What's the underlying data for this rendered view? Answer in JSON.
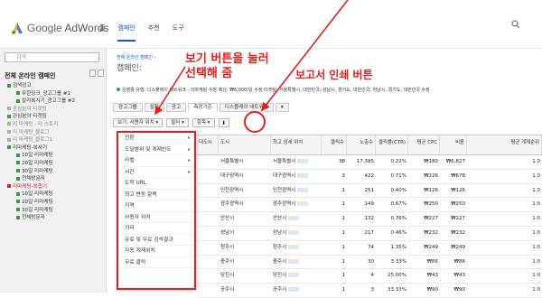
{
  "app": {
    "logo_google": "Google",
    "logo_product": "AdWords",
    "nav": [
      "홈",
      "캠페인",
      "추천",
      "도구"
    ]
  },
  "sidebar": {
    "search_placeholder": "검색",
    "title": "전체 온라인 캠페인",
    "items": [
      {
        "label": "검색광고",
        "level": 1,
        "state": "active"
      },
      {
        "label": "무한잉크_광고그룹 #1",
        "level": 2,
        "state": "active"
      },
      {
        "label": "칼라복사기_광고그룹 #2",
        "level": 2,
        "state": "active"
      },
      {
        "label": "판심분야 타겟팅",
        "level": 1,
        "state": "paused"
      },
      {
        "label": "관심분야 타겟팅",
        "level": 1,
        "state": "active"
      },
      {
        "label": "리 마케팅 - 타 스토리",
        "level": 1,
        "state": "paused"
      },
      {
        "label": "리 마케팅_블로그",
        "level": 1,
        "state": "paused"
      },
      {
        "label": "리 마케팅_블로그1",
        "level": 1,
        "state": "paused"
      },
      {
        "label": "리마케팅-복사기",
        "level": 1,
        "state": "active"
      },
      {
        "label": "10일 리마케팅",
        "level": 2,
        "state": "active"
      },
      {
        "label": "20일 리마케팅",
        "level": 2,
        "state": "active"
      },
      {
        "label": "30일 리마케팅",
        "level": 2,
        "state": "active"
      },
      {
        "label": "전체방문자",
        "level": 2,
        "state": "active"
      },
      {
        "label": "리마케팅-복합기",
        "level": 1,
        "state": "selected"
      },
      {
        "label": "10일 리마케팅",
        "level": 2,
        "state": "active"
      },
      {
        "label": "20일 리마케팅",
        "level": 2,
        "state": "active"
      },
      {
        "label": "30일 리마케팅",
        "level": 2,
        "state": "active"
      },
      {
        "label": "전체방문자",
        "level": 2,
        "state": "active"
      }
    ]
  },
  "main": {
    "breadcrumb": "전체 온라인 캠페인 ›",
    "campaign_label": "캠페인:",
    "status_line": "운영중   유형: 디스플레이 네트워크 - 리마케팅 수정   예산: ₩6,000/일 수정   타겟팅: 서울특별시, 대한민국; 성남시, 경기도, 대한민국; 하남시, 경기도, 대한민국 수정",
    "tabs": [
      "광고그룹",
      "설정",
      "광고",
      "측정기준",
      "디스플레이 네트워크",
      "▾"
    ],
    "toolbar": {
      "view_button": "보기: 사용자 위치 ▾",
      "filter_button": "필터 ▾",
      "columns_button": "항목 ▾",
      "download_icon": "⬇"
    }
  },
  "dropdown_menu": [
    {
      "label": "전환",
      "submenu": true
    },
    {
      "label": "도달범위 및 게재빈도",
      "submenu": true
    },
    {
      "label": "라벨",
      "submenu": true
    },
    {
      "label": "시간",
      "submenu": true
    },
    {
      "label": "도착 URL",
      "submenu": false
    },
    {
      "label": "최고 변동 항목",
      "submenu": false
    },
    {
      "label": "지역",
      "submenu": false
    },
    {
      "label": "사용자 위치",
      "submenu": false
    },
    {
      "label": "거리",
      "submenu": false
    },
    {
      "label": "유료 및 무료 검색결과",
      "submenu": false
    },
    {
      "label": "자동 게재위치",
      "submenu": false
    },
    {
      "label": "무료 클릭",
      "submenu": false
    }
  ],
  "table": {
    "headers": [
      "대도시",
      "도시",
      "최고 상세 위치",
      "클릭수",
      "노출수",
      "클릭률(CTR)",
      "평균 CPC",
      "비용",
      "평균 게재순위"
    ],
    "rows": [
      [
        "",
        "서울특별시",
        "서울특별시",
        "38",
        "17,385",
        "0.22%",
        "₩180",
        "₩6,827",
        "1.0"
      ],
      [
        "",
        "대구광역시",
        "대구광역시",
        "3",
        "422",
        "0.71%",
        "₩226",
        "₩678",
        "1.0"
      ],
      [
        "",
        "인천광역시",
        "인천광역시",
        "1",
        "251",
        "0.40%",
        "₩126",
        "₩126",
        "1.0"
      ],
      [
        "",
        "광주광역시",
        "광주광역시",
        "1",
        "149",
        "0.67%",
        "₩250",
        "₩250",
        "1.0"
      ],
      [
        "",
        "안산시",
        "안산시",
        "1",
        "132",
        "0.76%",
        "₩227",
        "₩227",
        "1.0"
      ],
      [
        "",
        "성남시",
        "성남시",
        "1",
        "217",
        "0.46%",
        "₩232",
        "₩232",
        "1.0"
      ],
      [
        "",
        "청주시",
        "청주시",
        "1",
        "74",
        "1.35%",
        "₩249",
        "₩249",
        "1.0"
      ],
      [
        "",
        "충주시",
        "충주시",
        "1",
        "30",
        "3.33%",
        "₩86",
        "₩86",
        "1.0"
      ],
      [
        "",
        "당진시",
        "당진시",
        "1",
        "4",
        "25.00%",
        "₩43",
        "₩43",
        "1.0"
      ],
      [
        "",
        "공주시",
        "공주시",
        "1",
        "3",
        "33.33%",
        "₩90",
        "₩90",
        "1.0"
      ]
    ]
  },
  "annotations": {
    "view_button_note_line1": "보기 버튼을 눌러",
    "view_button_note_line2": "선택해 줌",
    "report_print_note": "보고서 인쇄 버튼"
  },
  "colors": {
    "accent": "#1a55c9",
    "annotation": "#e02020",
    "selected_campaign": "#c0282d",
    "active_status": "#3c9a3c"
  }
}
